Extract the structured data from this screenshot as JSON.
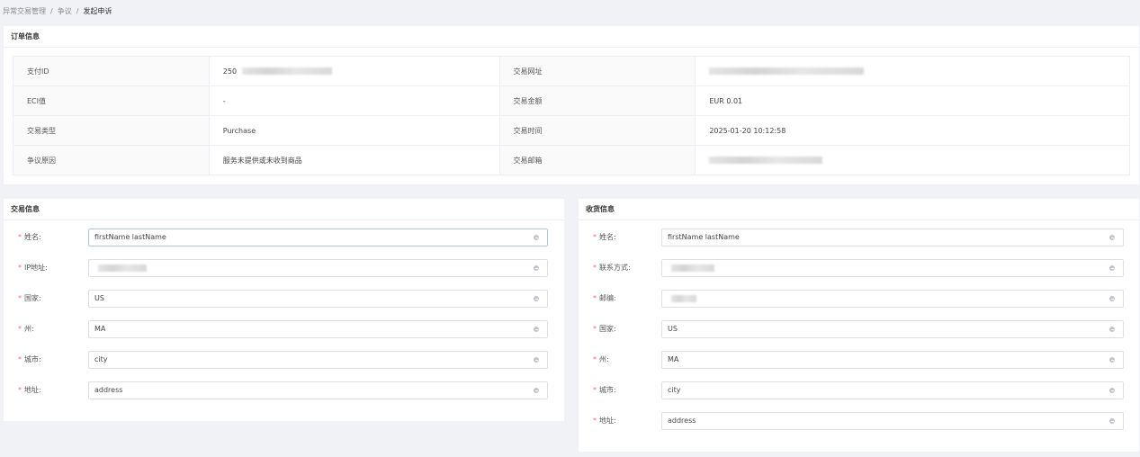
{
  "breadcrumb": {
    "items": [
      "异常交易管理",
      "争议",
      "发起申诉"
    ],
    "separator": "/"
  },
  "order_info": {
    "title": "订单信息",
    "rows": [
      {
        "label1": "支付ID",
        "value1": "250",
        "label2": "交易网址",
        "value2": ""
      },
      {
        "label1": "ECI值",
        "value1": "-",
        "label2": "交易金额",
        "value2": "EUR 0.01"
      },
      {
        "label1": "交易类型",
        "value1": "Purchase",
        "label2": "交易时间",
        "value2": "2025-01-20 10:12:58"
      },
      {
        "label1": "争议原因",
        "value1": "服务未提供或未收到商品",
        "label2": "交易邮箱",
        "value2": ""
      }
    ]
  },
  "transaction_info": {
    "title": "交易信息",
    "fields": [
      {
        "label": "姓名:",
        "value": "firstName lastName"
      },
      {
        "label": "IP地址:",
        "value": ""
      },
      {
        "label": "国家:",
        "value": "US"
      },
      {
        "label": "州:",
        "value": "MA"
      },
      {
        "label": "城市:",
        "value": "city"
      },
      {
        "label": "地址:",
        "value": "address"
      }
    ]
  },
  "shipping_info": {
    "title": "收货信息",
    "fields": [
      {
        "label": "姓名:",
        "value": "firstName lastName"
      },
      {
        "label": "联系方式:",
        "value": ""
      },
      {
        "label": "邮编:",
        "value": ""
      },
      {
        "label": "国家:",
        "value": "US"
      },
      {
        "label": "州:",
        "value": "MA"
      },
      {
        "label": "城市:",
        "value": "city"
      },
      {
        "label": "地址:",
        "value": "address"
      }
    ]
  },
  "required_marker": "*",
  "colors": {
    "background": "#f0f2f5",
    "required": "#f56c6c",
    "border": "#dcdfe6",
    "label_bg": "#fafafa"
  }
}
